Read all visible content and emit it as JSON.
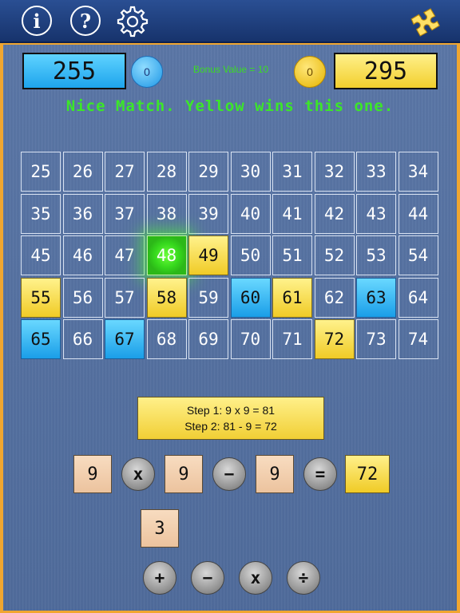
{
  "toolbar": {
    "info_label": "i",
    "help_label": "?",
    "settings_icon": "gear-icon",
    "puzzle_icon": "puzzle-icon",
    "accent": "#1d3d7e"
  },
  "scores": {
    "blue": {
      "score": "255",
      "coins": "0",
      "color": "#1ea4ec"
    },
    "yellow": {
      "score": "295",
      "coins": "0",
      "color": "#f2cf2d"
    },
    "bonus": "Bonus Value = 10"
  },
  "message": "Nice Match. Yellow wins this one.",
  "grid": {
    "cells": [
      {
        "n": "25",
        "s": "empty"
      },
      {
        "n": "26",
        "s": "empty"
      },
      {
        "n": "27",
        "s": "empty"
      },
      {
        "n": "28",
        "s": "empty"
      },
      {
        "n": "29",
        "s": "empty"
      },
      {
        "n": "30",
        "s": "empty"
      },
      {
        "n": "31",
        "s": "empty"
      },
      {
        "n": "32",
        "s": "empty"
      },
      {
        "n": "33",
        "s": "empty"
      },
      {
        "n": "34",
        "s": "empty"
      },
      {
        "n": "35",
        "s": "empty"
      },
      {
        "n": "36",
        "s": "empty"
      },
      {
        "n": "37",
        "s": "empty"
      },
      {
        "n": "38",
        "s": "empty"
      },
      {
        "n": "39",
        "s": "empty"
      },
      {
        "n": "40",
        "s": "empty"
      },
      {
        "n": "41",
        "s": "empty"
      },
      {
        "n": "42",
        "s": "empty"
      },
      {
        "n": "43",
        "s": "empty"
      },
      {
        "n": "44",
        "s": "empty"
      },
      {
        "n": "45",
        "s": "empty"
      },
      {
        "n": "46",
        "s": "empty"
      },
      {
        "n": "47",
        "s": "empty"
      },
      {
        "n": "48",
        "s": "green"
      },
      {
        "n": "49",
        "s": "yellow"
      },
      {
        "n": "50",
        "s": "empty"
      },
      {
        "n": "51",
        "s": "empty"
      },
      {
        "n": "52",
        "s": "empty"
      },
      {
        "n": "53",
        "s": "empty"
      },
      {
        "n": "54",
        "s": "empty"
      },
      {
        "n": "55",
        "s": "yellow"
      },
      {
        "n": "56",
        "s": "empty"
      },
      {
        "n": "57",
        "s": "empty"
      },
      {
        "n": "58",
        "s": "yellow"
      },
      {
        "n": "59",
        "s": "empty"
      },
      {
        "n": "60",
        "s": "blue"
      },
      {
        "n": "61",
        "s": "yellow"
      },
      {
        "n": "62",
        "s": "empty"
      },
      {
        "n": "63",
        "s": "blue"
      },
      {
        "n": "64",
        "s": "empty"
      },
      {
        "n": "65",
        "s": "blue"
      },
      {
        "n": "66",
        "s": "empty"
      },
      {
        "n": "67",
        "s": "blue"
      },
      {
        "n": "68",
        "s": "empty"
      },
      {
        "n": "69",
        "s": "empty"
      },
      {
        "n": "70",
        "s": "empty"
      },
      {
        "n": "71",
        "s": "empty"
      },
      {
        "n": "72",
        "s": "yellow"
      },
      {
        "n": "73",
        "s": "empty"
      },
      {
        "n": "74",
        "s": "empty"
      }
    ]
  },
  "steps": {
    "line1": "Step 1:  9 x 9 = 81",
    "line2": "Step 2:  81 - 9 = 72"
  },
  "equation": {
    "operand1": "9",
    "op1": "x",
    "operand2": "9",
    "op2": "−",
    "operand3": "9",
    "equals": "=",
    "result": "72"
  },
  "spare_tile": "3",
  "operators": {
    "plus": "+",
    "minus": "−",
    "times": "x",
    "divide": "÷"
  }
}
